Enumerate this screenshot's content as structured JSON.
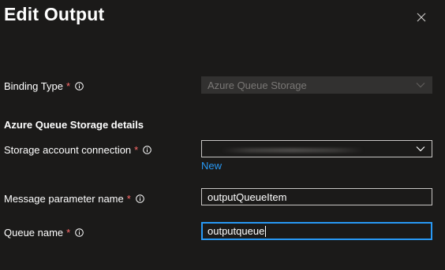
{
  "panel": {
    "title": "Edit Output"
  },
  "binding_type": {
    "label": "Binding Type",
    "required_mark": "*",
    "value": "Azure Queue Storage"
  },
  "section": {
    "heading": "Azure Queue Storage details"
  },
  "storage_connection": {
    "label": "Storage account connection",
    "required_mark": "*",
    "value": "",
    "new_link": "New"
  },
  "message_param": {
    "label": "Message parameter name",
    "required_mark": "*",
    "value": "outputQueueItem"
  },
  "queue_name": {
    "label": "Queue name",
    "required_mark": "*",
    "value": "outputqueue"
  },
  "icons": {
    "close": "close-icon",
    "info": "info-icon",
    "chevron": "chevron-down-icon"
  },
  "colors": {
    "background": "#1b1a19",
    "accent": "#2899f5",
    "required": "#ff6b6b",
    "disabled_bg": "#323130"
  }
}
